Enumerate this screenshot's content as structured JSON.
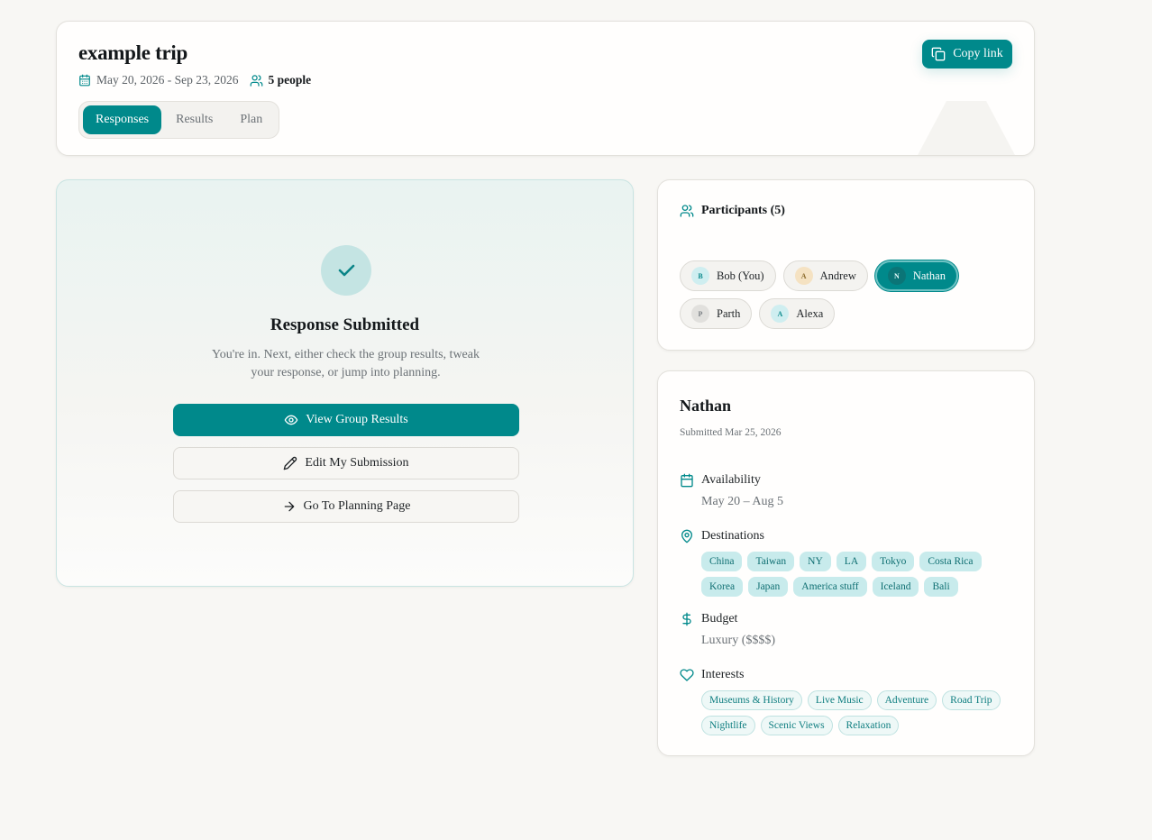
{
  "header": {
    "title": "example trip",
    "dates": "May 20, 2026 - Sep 23, 2026",
    "people": "5 people",
    "copy_label": "Copy link",
    "tabs": [
      {
        "label": "Responses",
        "active": true
      },
      {
        "label": "Results",
        "active": false
      },
      {
        "label": "Plan",
        "active": false
      }
    ]
  },
  "submission": {
    "title": "Response Submitted",
    "description": "You're in. Next, either check the group results, tweak your response, or jump into planning.",
    "buttons": {
      "view": "View Group Results",
      "edit": "Edit My Submission",
      "plan": "Go To Planning Page"
    }
  },
  "participants": {
    "heading": "Participants (5)",
    "list": [
      {
        "initial": "B",
        "name": "Bob (You)"
      },
      {
        "initial": "A",
        "name": "Andrew"
      },
      {
        "initial": "N",
        "name": "Nathan",
        "selected": true
      },
      {
        "initial": "P",
        "name": "Parth"
      },
      {
        "initial": "A",
        "name": "Alexa"
      }
    ]
  },
  "detail": {
    "name": "Nathan",
    "submitted": "Submitted Mar 25, 2026",
    "availability": {
      "label": "Availability",
      "value": "May 20 – Aug 5"
    },
    "destinations": {
      "label": "Destinations",
      "items": [
        "China",
        "Taiwan",
        "NY",
        "LA",
        "Tokyo",
        "Costa Rica",
        "Korea",
        "Japan",
        "America stuff",
        "Iceland",
        "Bali"
      ]
    },
    "budget": {
      "label": "Budget",
      "value": "Luxury ($$$$)"
    },
    "interests": {
      "label": "Interests",
      "items": [
        "Museums & History",
        "Live Music",
        "Adventure",
        "Road Trip",
        "Nightlife",
        "Scenic Views",
        "Relaxation"
      ]
    }
  },
  "colors": {
    "accent": "#00898b",
    "background": "#f8f7f4",
    "tag_bg": "#c8ebec"
  }
}
